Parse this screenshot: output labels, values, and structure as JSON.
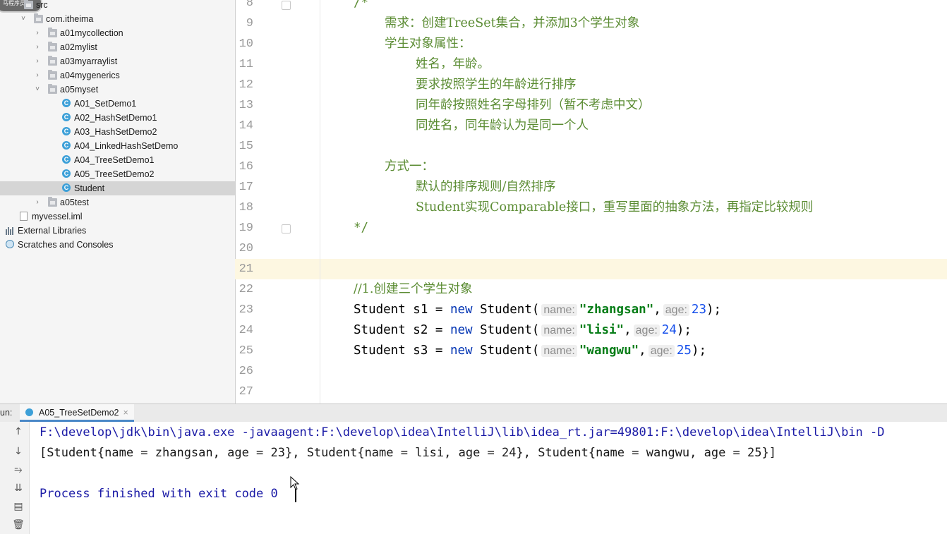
{
  "project_tree": {
    "badge": "马程序员",
    "items": [
      {
        "label": "src",
        "icon": "folder-icon",
        "arrow": "",
        "selected": false
      },
      {
        "label": "com.itheima",
        "icon": "package-icon",
        "arrow": "˅",
        "selected": false
      },
      {
        "label": "a01mycollection",
        "icon": "package-icon",
        "arrow": "›",
        "selected": false
      },
      {
        "label": "a02mylist",
        "icon": "package-icon",
        "arrow": "›",
        "selected": false
      },
      {
        "label": "a03myarraylist",
        "icon": "package-icon",
        "arrow": "›",
        "selected": false
      },
      {
        "label": "a04mygenerics",
        "icon": "package-icon",
        "arrow": "›",
        "selected": false
      },
      {
        "label": "a05myset",
        "icon": "package-icon",
        "arrow": "˅",
        "selected": false
      },
      {
        "label": "A01_SetDemo1",
        "icon": "class-icon",
        "arrow": "",
        "selected": false
      },
      {
        "label": "A02_HashSetDemo1",
        "icon": "class-icon",
        "arrow": "",
        "selected": false
      },
      {
        "label": "A03_HashSetDemo2",
        "icon": "class-icon",
        "arrow": "",
        "selected": false
      },
      {
        "label": "A04_LinkedHashSetDemo",
        "icon": "class-icon",
        "arrow": "",
        "selected": false
      },
      {
        "label": "A04_TreeSetDemo1",
        "icon": "class-icon",
        "arrow": "",
        "selected": false
      },
      {
        "label": "A05_TreeSetDemo2",
        "icon": "class-icon",
        "arrow": "",
        "selected": false
      },
      {
        "label": "Student",
        "icon": "class-icon",
        "arrow": "",
        "selected": true
      },
      {
        "label": "a05test",
        "icon": "package-icon",
        "arrow": "›",
        "selected": false
      },
      {
        "label": "myvessel.iml",
        "icon": "iml-file-icon",
        "arrow": "",
        "selected": false
      },
      {
        "label": "External Libraries",
        "icon": "libraries-icon",
        "arrow": "",
        "selected": false
      },
      {
        "label": "Scratches and Consoles",
        "icon": "scratches-icon",
        "arrow": "",
        "selected": false
      }
    ]
  },
  "editor": {
    "current_line": "21",
    "lines": [
      {
        "no": "8",
        "text": "/*"
      },
      {
        "no": "9",
        "text": "需求：创建TreeSet集合，并添加3个学生对象"
      },
      {
        "no": "10",
        "text": "学生对象属性："
      },
      {
        "no": "11",
        "text": "姓名，年龄。"
      },
      {
        "no": "12",
        "text": "要求按照学生的年龄进行排序"
      },
      {
        "no": "13",
        "text": "同年龄按照姓名字母排列（暂不考虑中文）"
      },
      {
        "no": "14",
        "text": "同姓名，同年龄认为是同一个人"
      },
      {
        "no": "15",
        "text": ""
      },
      {
        "no": "16",
        "text": "方式一："
      },
      {
        "no": "17",
        "text": "默认的排序规则/自然排序"
      },
      {
        "no": "18",
        "text": "Student实现Comparable接口，重写里面的抽象方法，再指定比较规则"
      },
      {
        "no": "19",
        "text": "*/"
      },
      {
        "no": "20",
        "text": ""
      },
      {
        "no": "21",
        "text": ""
      },
      {
        "no": "22",
        "text": "//1.创建三个学生对象"
      },
      {
        "no": "23",
        "text": ""
      },
      {
        "no": "24",
        "text": ""
      },
      {
        "no": "25",
        "text": ""
      },
      {
        "no": "26",
        "text": ""
      },
      {
        "no": "27",
        "text": ""
      }
    ],
    "statements": [
      {
        "decl": "Student s1 = ",
        "kw": "new",
        "ctor": " Student(",
        "hint_name": "name:",
        "name": "\"zhangsan\"",
        "sep": ",",
        "hint_age": "age:",
        "age": "23",
        "end": ");"
      },
      {
        "decl": "Student s2 = ",
        "kw": "new",
        "ctor": " Student(",
        "hint_name": "name:",
        "name": "\"lisi\"",
        "sep": ",",
        "hint_age": "age:",
        "age": "24",
        "end": ");"
      },
      {
        "decl": "Student s3 = ",
        "kw": "new",
        "ctor": " Student(",
        "hint_name": "name:",
        "name": "\"wangwu\"",
        "sep": ",",
        "hint_age": "age:",
        "age": "25",
        "end": ");"
      }
    ]
  },
  "run_panel": {
    "label": "un:",
    "tab_label": "A05_TreeSetDemo2",
    "tab_close": "×",
    "toolbar_icons": [
      "arrow-up-icon",
      "arrow-down-icon",
      "soft-wrap-icon",
      "scroll-to-end-icon",
      "print-icon",
      "trash-icon"
    ],
    "toolbar_glyphs": [
      "↑",
      "↓",
      "⥱",
      "⇊",
      "▤",
      "🗑"
    ],
    "console": {
      "command": "F:\\develop\\jdk\\bin\\java.exe -javaagent:F:\\develop\\idea\\IntelliJ\\lib\\idea_rt.jar=49801:F:\\develop\\idea\\IntelliJ\\bin -D",
      "output": "[Student{name = zhangsan, age = 23}, Student{name = lisi, age = 24}, Student{name = wangwu, age = 25}]",
      "exit": "Process finished with exit code 0"
    }
  }
}
